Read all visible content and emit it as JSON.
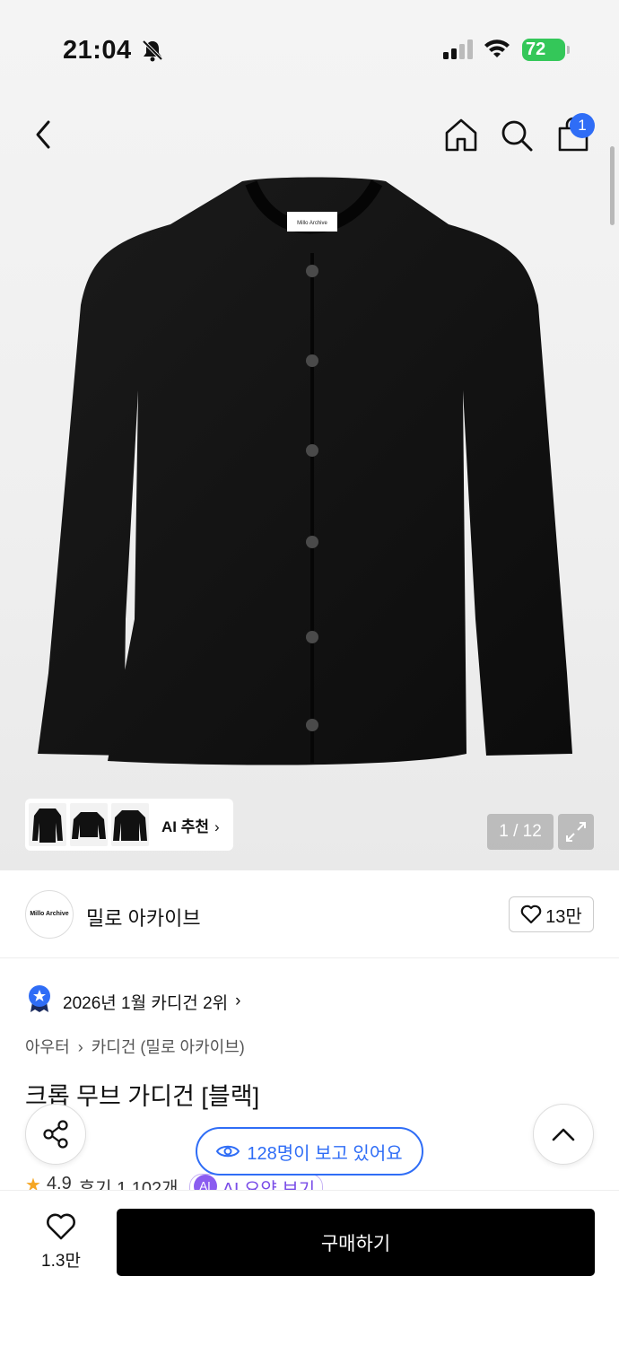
{
  "status_bar": {
    "time": "21:04",
    "battery": "72"
  },
  "nav": {
    "cart_count": "1"
  },
  "gallery": {
    "ai_recommend_label": "AI 추천",
    "ai_recommend_chevron": "›",
    "counter": "1 / 12",
    "product_tag_text": "Millo Archive"
  },
  "brand": {
    "logo_text": "Millo Archive",
    "name": "밀로 아카이브",
    "likes": "13만"
  },
  "ranking": {
    "text": "2026년 1월 카디건 2위",
    "chevron": "›"
  },
  "breadcrumb": {
    "category": "아우터",
    "separator": "›",
    "subcategory": "카디건 (밀로 아카이브)"
  },
  "product": {
    "title": "크롭 무브 가디건 [블랙]"
  },
  "viewers": {
    "text": "128명이 보고 있어요"
  },
  "rating": {
    "score": "4.9",
    "reviews": "후기 1,102개",
    "ai_badge": "AI",
    "ai_summary": "AI 요약 보기"
  },
  "bottom": {
    "wish_count": "1.3만",
    "buy_label": "구매하기"
  },
  "colors": {
    "accent": "#2f6df6",
    "battery": "#34c759",
    "star": "#f5a623",
    "ai_purple": "#8a5cf0"
  },
  "icons": [
    "bell-off-icon",
    "signal-icon",
    "wifi-icon",
    "back-icon",
    "home-icon",
    "search-icon",
    "bag-icon",
    "expand-icon",
    "heart-icon",
    "medal-icon",
    "share-icon",
    "chevron-up-icon",
    "eye-icon",
    "star-icon"
  ]
}
